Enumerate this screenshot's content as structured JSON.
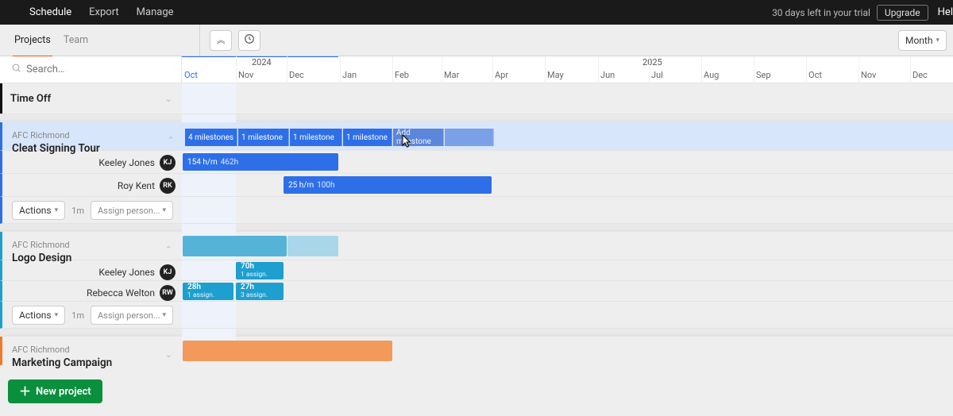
{
  "topnav": {
    "schedule": "Schedule",
    "export": "Export",
    "manage": "Manage",
    "trial": "30 days left in your trial",
    "upgrade": "Upgrade",
    "help": "Hel"
  },
  "subnav": {
    "projects": "Projects",
    "team": "Team",
    "viewmode": "Month"
  },
  "search_placeholder": "Search…",
  "years": {
    "y2024": "2024",
    "y2025": "2025"
  },
  "months": [
    "Oct",
    "Nov",
    "Dec",
    "Jan",
    "Feb",
    "Mar",
    "Apr",
    "May",
    "Jun",
    "Jul",
    "Aug",
    "Sep",
    "Oct",
    "Nov",
    "Dec"
  ],
  "timeoff": {
    "title": "Time Off"
  },
  "cleat": {
    "org": "AFC Richmond",
    "name": "Cleat Signing Tour",
    "milestones": [
      "4 milestones",
      "1 milestone",
      "1 milestone",
      "1 milestone",
      "Add milestone"
    ],
    "kj": {
      "name": "Keeley Jones",
      "initials": "KJ",
      "bar": "154 h/m",
      "bar_sub": "462h"
    },
    "rk": {
      "name": "Roy Kent",
      "initials": "RK",
      "bar": "25 h/m",
      "bar_sub": "100h"
    },
    "actions": "Actions",
    "mo": "1m",
    "assign": "Assign person..."
  },
  "logo": {
    "org": "AFC Richmond",
    "name": "Logo Design",
    "kj": {
      "name": "Keeley Jones",
      "initials": "KJ",
      "bar_big": "70h",
      "bar_small": "1 assign."
    },
    "rw": {
      "name": "Rebecca Welton",
      "initials": "RW",
      "bar1_big": "28h",
      "bar1_small": "1 assign.",
      "bar2_big": "27h",
      "bar2_small": "3 assign."
    },
    "actions": "Actions",
    "mo": "1m",
    "assign": "Assign person..."
  },
  "mkt": {
    "org": "AFC Richmond",
    "name": "Marketing Campaign"
  },
  "newproject": "New project"
}
